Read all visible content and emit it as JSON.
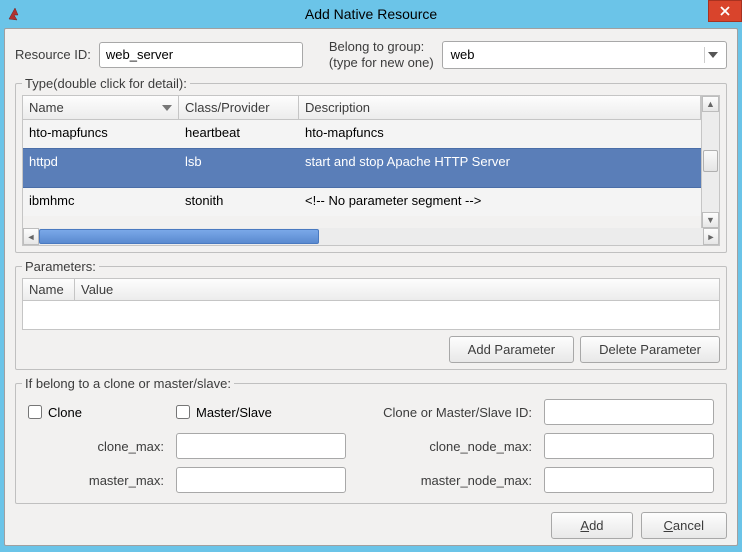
{
  "window": {
    "title": "Add Native Resource"
  },
  "resource_id": {
    "label": "Resource ID:",
    "value": "web_server"
  },
  "group": {
    "label_line1": "Belong to group:",
    "label_line2": "(type for new one)",
    "value": "web"
  },
  "type_section": {
    "legend": "Type(double click for detail):",
    "columns": {
      "name": "Name",
      "class": "Class/Provider",
      "desc": "Description"
    },
    "rows": [
      {
        "name": "hto-mapfuncs",
        "class": "heartbeat",
        "desc": "hto-mapfuncs",
        "selected": false
      },
      {
        "name": "httpd",
        "class": "lsb",
        "desc": "start and stop Apache HTTP Server",
        "selected": true
      },
      {
        "name": "ibmhmc",
        "class": "stonith",
        "desc": "<!-- No parameter segment -->",
        "selected": false
      }
    ]
  },
  "params_section": {
    "legend": "Parameters:",
    "columns": {
      "name": "Name",
      "value": "Value"
    },
    "add_btn": "Add Parameter",
    "del_btn": "Delete Parameter"
  },
  "clone_section": {
    "legend": "If belong to a clone or master/slave:",
    "clone_label": "Clone",
    "ms_label": "Master/Slave",
    "id_label": "Clone or Master/Slave ID:",
    "clone_max": "clone_max:",
    "clone_node_max": "clone_node_max:",
    "master_max": "master_max:",
    "master_node_max": "master_node_max:"
  },
  "dialog_btns": {
    "add": "Add",
    "cancel": "Cancel"
  }
}
